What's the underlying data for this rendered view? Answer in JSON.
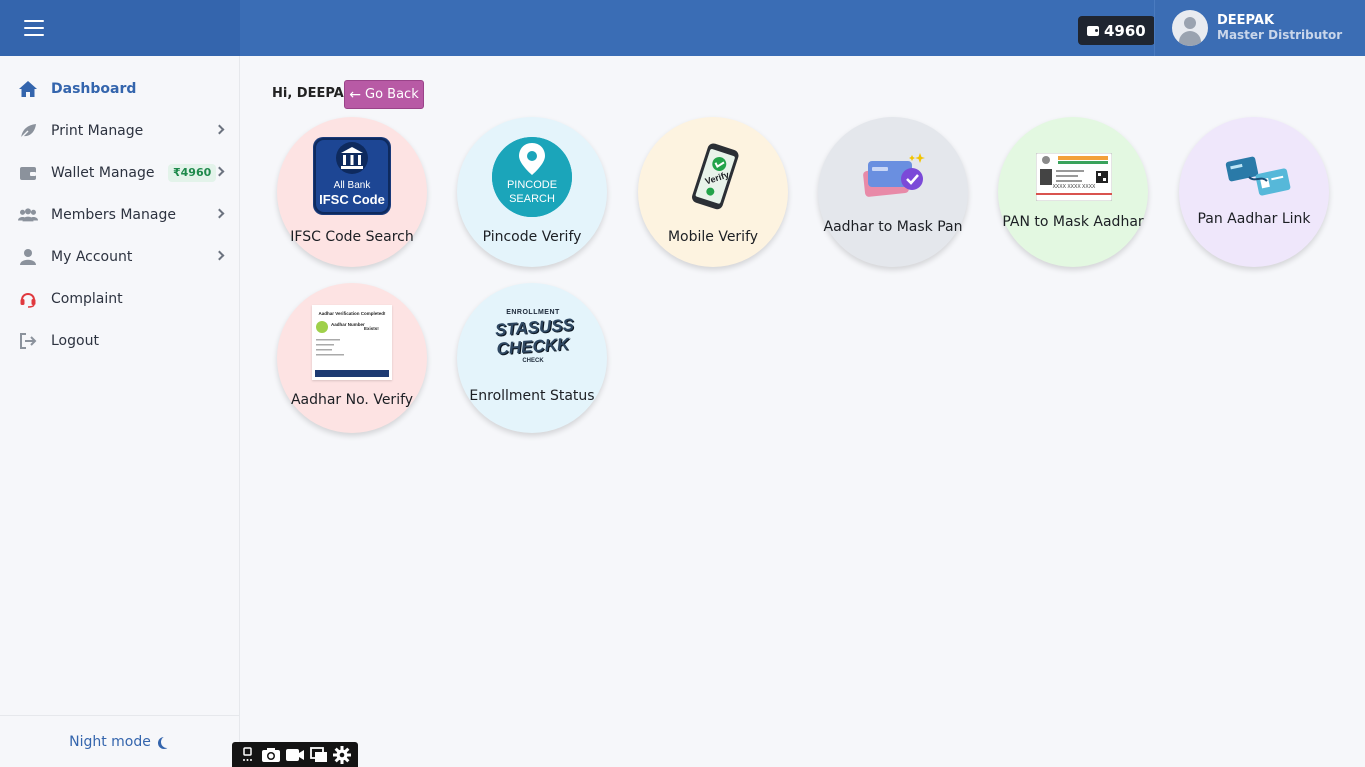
{
  "header": {
    "wallet_amount": "4960",
    "user_name": "DEEPAK",
    "user_role": "Master Distributor"
  },
  "sidebar": {
    "items": [
      {
        "label": "Dashboard",
        "icon": "home-icon",
        "active": true
      },
      {
        "label": "Print Manage",
        "icon": "leaf-icon"
      },
      {
        "label": "Wallet Manage",
        "icon": "wallet-icon",
        "badge": "₹4960"
      },
      {
        "label": "Members Manage",
        "icon": "users-icon"
      },
      {
        "label": "My Account",
        "icon": "user-icon"
      },
      {
        "label": "Complaint",
        "icon": "headset-icon"
      },
      {
        "label": "Logout",
        "icon": "logout-icon"
      }
    ],
    "night_mode_label": "Night mode"
  },
  "main": {
    "greeting": "Hi, DEEPAK",
    "go_back_label": "Go Back",
    "tiles": [
      {
        "label": "IFSC Code Search",
        "color": "#fde3e3",
        "art_line1": "All Bank",
        "art_line2": "IFSC Code"
      },
      {
        "label": "Pincode Verify",
        "color": "#e4f4fb",
        "art_line1": "PINCODE",
        "art_line2": "SEARCH"
      },
      {
        "label": "Mobile Verify",
        "color": "#fdf3e0",
        "art_text": "Verify"
      },
      {
        "label": "Aadhar to Mask Pan",
        "color": "#e4e7ec"
      },
      {
        "label": "PAN to Mask Aadhar",
        "color": "#e3f8e1",
        "art_text": "XXXX XXXX XXXX"
      },
      {
        "label": "Pan Aadhar Link",
        "color": "#efe7fb"
      },
      {
        "label": "Aadhar No. Verify",
        "color": "#fde3e3",
        "art_title": "Aadhar Verification Completed!",
        "art_line1": "Aadhar Number",
        "art_line2": "Exists!"
      },
      {
        "label": "Enrollment Status",
        "color": "#e4f4fb",
        "art_top": "ENROLLMENT",
        "art_line1": "STASUSS",
        "art_line2": "CHECKK",
        "art_bottom": "CHECK"
      }
    ]
  },
  "colors": {
    "header_bg": "#3a6db5",
    "accent": "#3465ad",
    "go_back_bg": "#b85aa5"
  }
}
